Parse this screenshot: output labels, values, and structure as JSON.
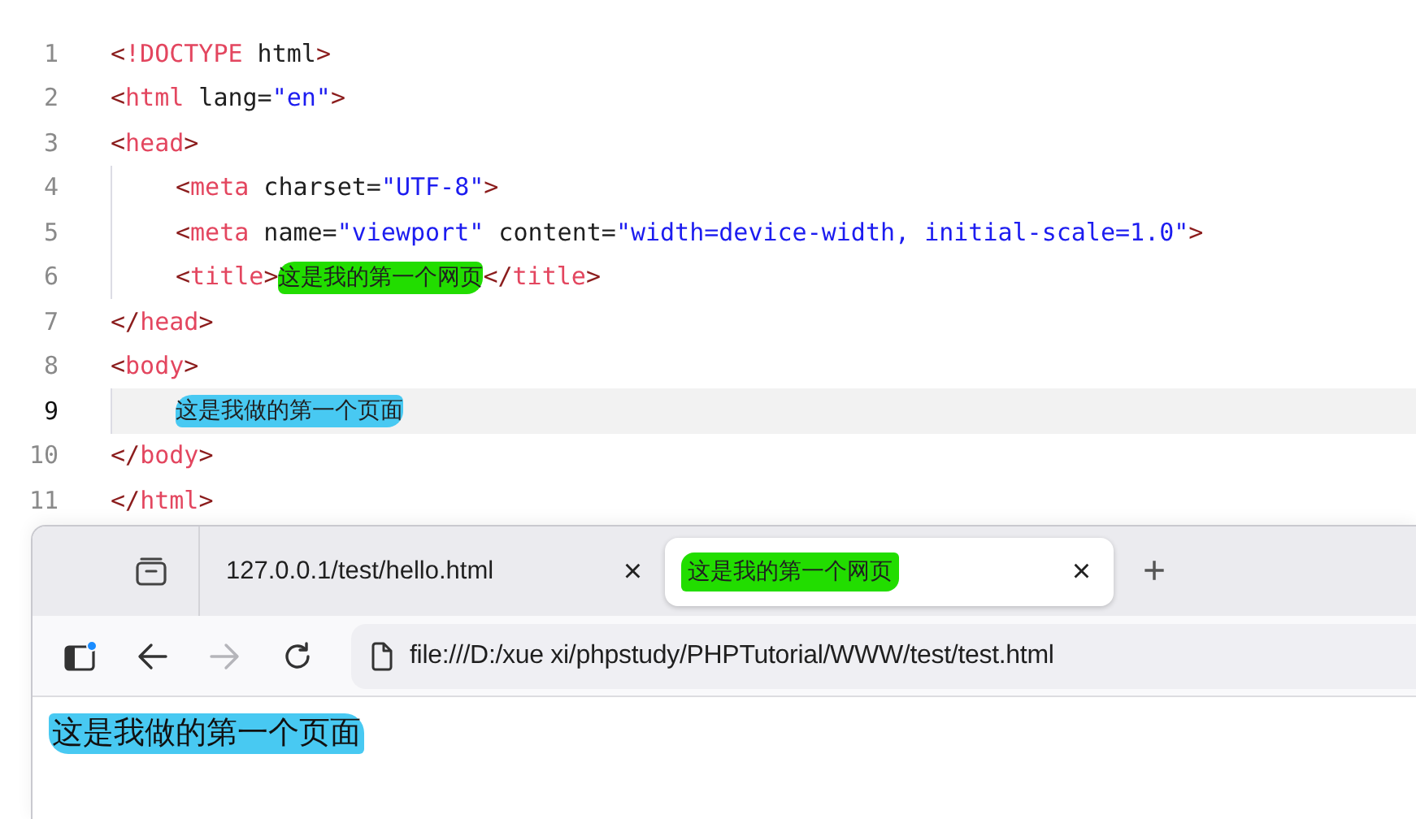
{
  "editor": {
    "lines": [
      {
        "number": "1",
        "current": false,
        "tokens": [
          {
            "kind": "bracket",
            "text": "<"
          },
          {
            "kind": "tag",
            "text": "!DOCTYPE"
          },
          {
            "kind": "plain",
            "text": " html"
          },
          {
            "kind": "bracket",
            "text": ">"
          }
        ]
      },
      {
        "number": "2",
        "current": false,
        "tokens": [
          {
            "kind": "bracket",
            "text": "<"
          },
          {
            "kind": "tag",
            "text": "html"
          },
          {
            "kind": "plain",
            "text": " lang="
          },
          {
            "kind": "string",
            "text": "\"en\""
          },
          {
            "kind": "bracket",
            "text": ">"
          }
        ]
      },
      {
        "number": "3",
        "current": false,
        "tokens": [
          {
            "kind": "bracket",
            "text": "<"
          },
          {
            "kind": "tag",
            "text": "head"
          },
          {
            "kind": "bracket",
            "text": ">"
          }
        ],
        "children": [
          {
            "number": "4",
            "current": false,
            "tokens": [
              {
                "kind": "bracket",
                "text": "<"
              },
              {
                "kind": "tag",
                "text": "meta"
              },
              {
                "kind": "plain",
                "text": " charset="
              },
              {
                "kind": "string",
                "text": "\"UTF-8\""
              },
              {
                "kind": "bracket",
                "text": ">"
              }
            ]
          },
          {
            "number": "5",
            "current": false,
            "tokens": [
              {
                "kind": "bracket",
                "text": "<"
              },
              {
                "kind": "tag",
                "text": "meta"
              },
              {
                "kind": "plain",
                "text": " name="
              },
              {
                "kind": "string",
                "text": "\"viewport\""
              },
              {
                "kind": "plain",
                "text": " content="
              },
              {
                "kind": "string",
                "text": "\"width=device-width, initial-scale=1.0\""
              },
              {
                "kind": "bracket",
                "text": ">"
              }
            ]
          },
          {
            "number": "6",
            "current": false,
            "tokens": [
              {
                "kind": "bracket",
                "text": "<"
              },
              {
                "kind": "tag",
                "text": "title"
              },
              {
                "kind": "bracket",
                "text": ">"
              },
              {
                "kind": "text",
                "text": "这是我的第一个网页",
                "color": "#22dd00"
              },
              {
                "kind": "bracket",
                "text": "</"
              },
              {
                "kind": "tag",
                "text": "title"
              },
              {
                "kind": "bracket",
                "text": ">"
              }
            ]
          }
        ]
      },
      {
        "number": "7",
        "current": false,
        "tokens": [
          {
            "kind": "bracket",
            "text": "</"
          },
          {
            "kind": "tag",
            "text": "head"
          },
          {
            "kind": "bracket",
            "text": ">"
          }
        ]
      },
      {
        "number": "8",
        "current": false,
        "tokens": [
          {
            "kind": "bracket",
            "text": "<"
          },
          {
            "kind": "tag",
            "text": "body"
          },
          {
            "kind": "bracket",
            "text": ">"
          }
        ],
        "children": [
          {
            "number": "9",
            "current": true,
            "tokens": [
              {
                "kind": "text",
                "text": "这是我做的第一个页面",
                "color": "#48c9f2"
              }
            ]
          }
        ]
      },
      {
        "number": "10",
        "current": false,
        "tokens": [
          {
            "kind": "bracket",
            "text": "</"
          },
          {
            "kind": "tag",
            "text": "body"
          },
          {
            "kind": "bracket",
            "text": ">"
          }
        ]
      },
      {
        "number": "11",
        "current": false,
        "tokens": [
          {
            "kind": "bracket",
            "text": "</"
          },
          {
            "kind": "tag",
            "text": "html"
          },
          {
            "kind": "bracket",
            "text": ">"
          }
        ]
      }
    ]
  },
  "browser": {
    "tabs": [
      {
        "label": "127.0.0.1/test/hello.html",
        "selected": false,
        "close": "×"
      },
      {
        "label": "这是我的第一个网页",
        "selected": true,
        "color": "#22dd00",
        "close": "×"
      }
    ],
    "new_tab": "+",
    "sidebar_notification": true,
    "forward_disabled": true,
    "address": "file:///D:/xue xi/phpstudy/PHPTutorial/WWW/test/test.html",
    "page": {
      "text": "这是我做的第一个页面",
      "color": "#48c9f2"
    }
  }
}
